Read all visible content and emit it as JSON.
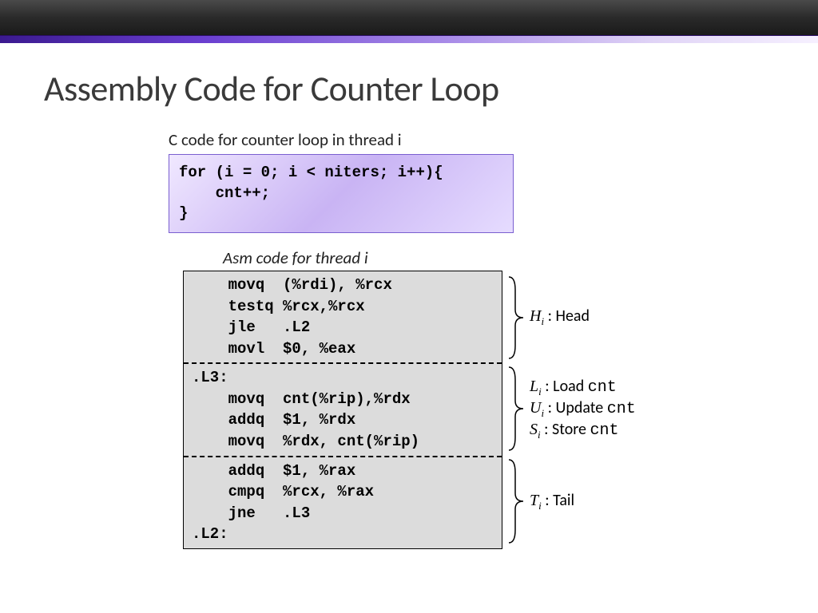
{
  "title": "Assembly Code for Counter Loop",
  "c_caption": "C code for counter loop in thread i",
  "c_code": "for (i = 0; i < niters; i++){\n    cnt++;\n}",
  "asm_caption": "Asm code for thread i",
  "asm": {
    "head": "    movq  (%rdi), %rcx\n    testq %rcx,%rcx\n    jle   .L2\n    movl  $0, %eax",
    "body": ".L3:\n    movq  cnt(%rip),%rdx\n    addq  $1, %rdx\n    movq  %rdx, cnt(%rip)",
    "tail": "    addq  $1, %rax\n    cmpq  %rcx, %rax\n    jne   .L3\n.L2:"
  },
  "anno": {
    "head": {
      "sym": "H",
      "sub": "i",
      "desc": "Head"
    },
    "load": {
      "sym": "L",
      "sub": "i",
      "verb": "Load",
      "obj": "cnt"
    },
    "update": {
      "sym": "U",
      "sub": "i",
      "verb": "Update",
      "obj": "cnt"
    },
    "store": {
      "sym": "S",
      "sub": "i",
      "verb": "Store",
      "obj": "cnt"
    },
    "tail": {
      "sym": "T",
      "sub": "i",
      "desc": "Tail"
    }
  }
}
